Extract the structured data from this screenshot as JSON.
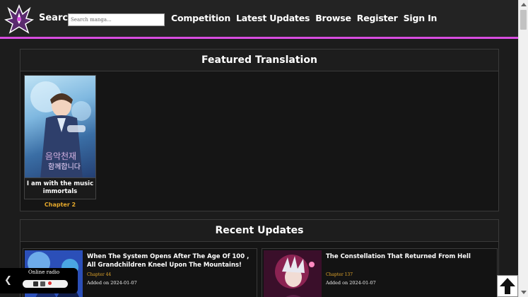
{
  "header": {
    "search_label": "Search",
    "search_placeholder": "Search manga...",
    "nav": [
      "Competition",
      "Latest Updates",
      "Browse",
      "Register",
      "Sign In"
    ],
    "accent_color": "#d84de0"
  },
  "featured": {
    "title": "Featured Translation",
    "cards": [
      {
        "title": "I am with the music immortals",
        "chapter": "Chapter 2",
        "cover_icon": "manga-cover-blue"
      }
    ]
  },
  "recent": {
    "title": "Recent Updates",
    "items": [
      {
        "title": "When The System Opens After The Age Of 100 , All Grandchildren Kneel Upon The Mountains!",
        "chapter": "Chapter 44",
        "added": "Added on 2024-01-07"
      },
      {
        "title": "The Constellation That Returned From Hell",
        "chapter": "Chapter 137",
        "added": "Added on 2024-01-07"
      }
    ]
  },
  "radio": {
    "label": "Online radio"
  },
  "colors": {
    "chapter": "#e6a92b",
    "background": "#1c1c1c"
  }
}
